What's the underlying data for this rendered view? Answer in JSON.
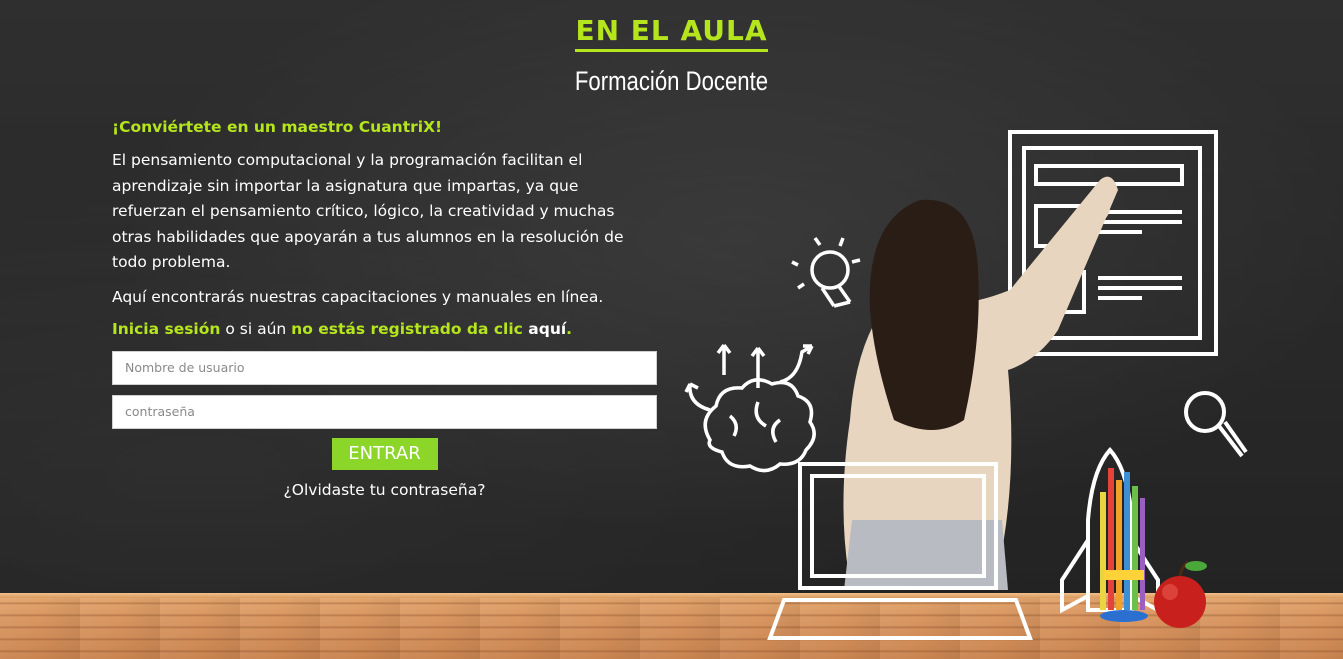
{
  "header": {
    "brand": "EN EL AULA",
    "subtitle": "Formación Docente"
  },
  "intro": {
    "headline": "¡Conviértete en un maestro CuantriX!",
    "paragraph": "El pensamiento computacional y la programación facilitan el aprendizaje sin importar la asignatura que impartas, ya que refuerzan el pensamiento crítico, lógico, la creatividad y muchas otras habilidades que apoyarán a tus alumnos en la resolución de todo problema.",
    "note": "Aquí encontrarás nuestras capacitaciones y manuales en línea."
  },
  "login_prompt": {
    "signin_link": "Inicia sesión",
    "middle": " o si aún ",
    "register_text": "no estás registrado da clic ",
    "here_link": "aquí",
    "period": "."
  },
  "form": {
    "username_placeholder": "Nombre de usuario",
    "password_placeholder": "contraseña",
    "submit_label": "ENTRAR",
    "forgot_label": "¿Olvidaste tu contraseña?"
  },
  "colors": {
    "accent": "#b5e61d",
    "button": "#8cd62a",
    "board": "#2b2b2b"
  },
  "illustration": {
    "icons": [
      "document-icon",
      "lightbulb-icon",
      "brain-icon",
      "magnifier-icon",
      "rocket-icon",
      "laptop-icon",
      "pencils-icon",
      "apple-icon"
    ]
  }
}
